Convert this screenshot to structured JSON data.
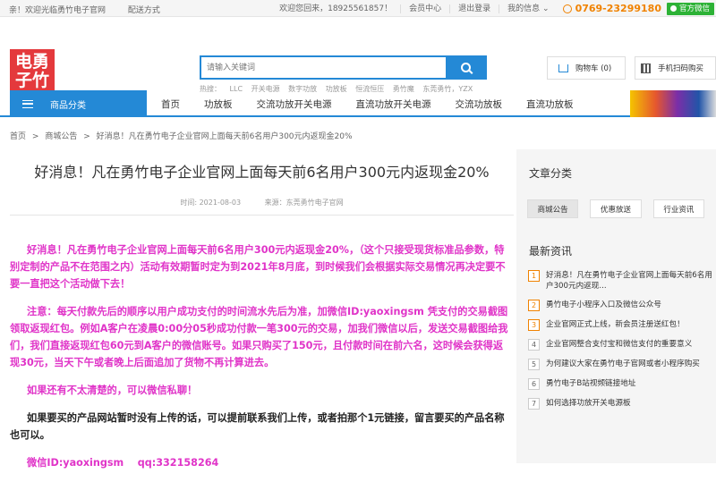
{
  "topbar": {
    "welcome": "亲！欢迎光临勇竹电子官网",
    "delivery": "配送方式",
    "greeting": "欢迎您回来，18925561857！",
    "member": "会员中心",
    "logout": "退出登录",
    "info": "我的信息",
    "phone": "0769-23299180",
    "wechat": "官方微信"
  },
  "logo": {
    "line1": "电勇",
    "line2": "子竹"
  },
  "search": {
    "placeholder": "请输入关键词",
    "hot_label": "热搜：",
    "hot": [
      "LLC",
      "开关电源",
      "数字功放",
      "功放板",
      "恒流恒压",
      "勇竹魔",
      "东莞勇竹，YZX"
    ]
  },
  "cart": {
    "label": "购物车 (0)"
  },
  "scan": {
    "label": "手机扫码购买"
  },
  "nav": {
    "category": "商品分类",
    "items": [
      "首页",
      "功放板",
      "交流功放开关电源",
      "直流功放开关电源",
      "交流功放板",
      "直流功放板"
    ]
  },
  "breadcrumb": [
    "首页",
    ">",
    "商城公告",
    ">",
    "好消息！凡在勇竹电子企业官网上面每天前6名用户300元内返现金20%"
  ],
  "article": {
    "title": "好消息！凡在勇竹电子企业官网上面每天前6名用户300元内返现金20%",
    "time": "时间: 2021-08-03",
    "source": "来源：东莞勇竹电子官网",
    "p1": "好消息！凡在勇竹电子企业官网上面每天前6名用户300元内返现金20%，（这个只接受现货标准品参数，特别定制的产品不在范围之内）活动有效期暂时定为到2021年8月底，到时候我们会根据实际交易情况再决定要不要一直把这个活动做下去！",
    "p2": "注意：每天付款先后的顺序以用户成功支付的时间流水先后为准，加微信ID:yaoxingsm 凭支付的交易截图领取返现红包。例如A客户在凌晨0:00分05秒成功付款一笔300元的交易，加我们微信以后，发送交易截图给我们，我们直接返现红包60元到A客户的微信账号。如果只购买了150元，且付款时间在前六名，这时候会获得返现30元，当天下午或者晚上后面追加了货物不再计算进去。",
    "p3": "如果还有不太清楚的，可以微信私聊！",
    "p4": "如果要买的产品网站暂时没有上传的话，可以提前联系我们上传，或者拍那个1元链接，留言要买的产品名称也可以。",
    "p5": "微信ID:yaoxingsm    qq:332158264"
  },
  "sidebar": {
    "category_title": "文章分类",
    "tags": [
      "商城公告",
      "优惠放送",
      "行业资讯"
    ],
    "news_title": "最新资讯",
    "news": [
      {
        "num": "1",
        "text": "好消息！凡在勇竹电子企业官网上面每天前6名用户300元内返现..."
      },
      {
        "num": "2",
        "text": "勇竹电子小程序入口及微信公众号"
      },
      {
        "num": "3",
        "text": "企业官网正式上线，新会员注册送红包！"
      },
      {
        "num": "4",
        "text": "企业官网整合支付宝和微信支付的重要意义"
      },
      {
        "num": "5",
        "text": "为何建议大家在勇竹电子官网或者小程序购买"
      },
      {
        "num": "6",
        "text": "勇竹电子B站视频链接地址"
      },
      {
        "num": "7",
        "text": "如何选择功放开关电源板"
      }
    ]
  },
  "colors": {
    "accent": "#2489d6",
    "brand_red": "#e4393c",
    "highlight": "#e034c8",
    "phone": "#f08200"
  }
}
